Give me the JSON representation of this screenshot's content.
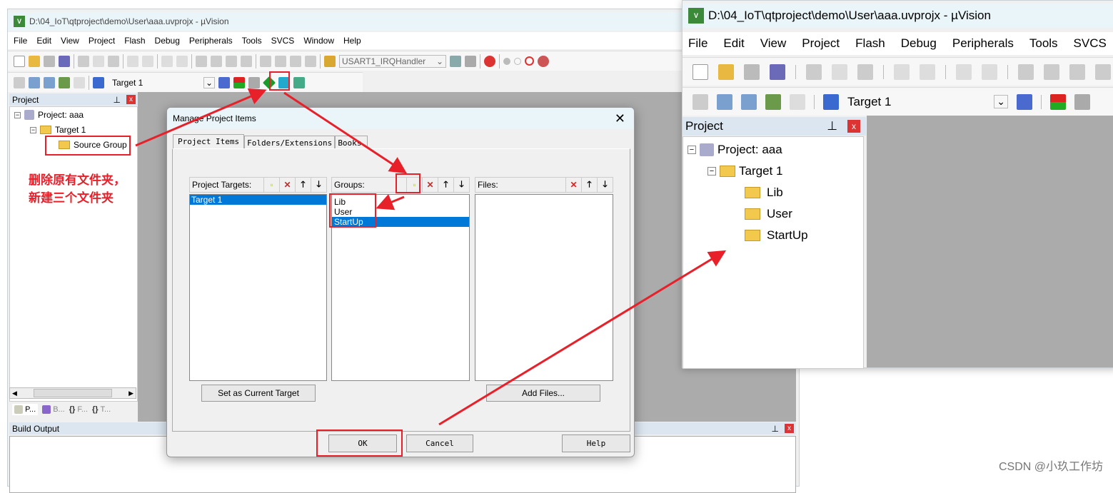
{
  "main_window": {
    "title": "D:\\04_IoT\\qtproject\\demo\\User\\aaa.uvprojx - µVision",
    "menu": [
      "File",
      "Edit",
      "View",
      "Project",
      "Flash",
      "Debug",
      "Peripherals",
      "Tools",
      "SVCS",
      "Window",
      "Help"
    ],
    "function_combo": "USART1_IRQHandler",
    "target_combo": "Target 1",
    "project_panel": {
      "title": "Project",
      "root": "Project: aaa",
      "target": "Target 1",
      "group": "Source Group",
      "tabs": [
        "P...",
        "B...",
        "F...",
        "T..."
      ]
    },
    "build_output": {
      "title": "Build Output"
    }
  },
  "dialog": {
    "title": "Manage Project Items",
    "tabs": [
      "Project Items",
      "Folders/Extensions",
      "Books"
    ],
    "targets": {
      "label": "Project Targets:",
      "items": [
        "Target 1"
      ],
      "selected": "Target 1",
      "button": "Set as Current Target"
    },
    "groups": {
      "label": "Groups:",
      "items": [
        "Lib",
        "User",
        "StartUp"
      ],
      "selected": "StartUp"
    },
    "files": {
      "label": "Files:",
      "button": "Add Files..."
    },
    "ok": "OK",
    "cancel": "Cancel",
    "help": "Help"
  },
  "result_window": {
    "title": "D:\\04_IoT\\qtproject\\demo\\User\\aaa.uvprojx - µVision",
    "menu": [
      "File",
      "Edit",
      "View",
      "Project",
      "Flash",
      "Debug",
      "Peripherals",
      "Tools",
      "SVCS"
    ],
    "target_combo": "Target 1",
    "project_panel": {
      "title": "Project",
      "root": "Project: aaa",
      "target": "Target 1",
      "groups": [
        "Lib",
        "User",
        "StartUp"
      ]
    }
  },
  "annotation": {
    "line1": "删除原有文件夹，",
    "line2": "新建三个文件夹",
    "color": "#e8202a"
  },
  "watermark": "CSDN @小玖工作坊"
}
